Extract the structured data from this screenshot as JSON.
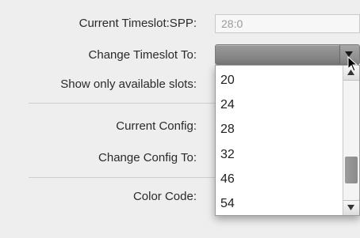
{
  "form": {
    "current_timeslot_label": "Current Timeslot:SPP:",
    "current_timeslot_value": "28:0",
    "change_timeslot_label": "Change Timeslot To:",
    "show_available_label": "Show only available slots:",
    "current_config_label": "Current Config:",
    "change_config_label": "Change Config To:",
    "color_code_label": "Color Code:"
  },
  "timeslot_dropdown": {
    "options": [
      "20",
      "24",
      "28",
      "32",
      "46",
      "54"
    ],
    "scroll_position": 0.82
  },
  "colors": {
    "panel_background": "#eeeeee",
    "dropdown_background": "#ffffff",
    "select_gray": "#8a8a8a"
  }
}
